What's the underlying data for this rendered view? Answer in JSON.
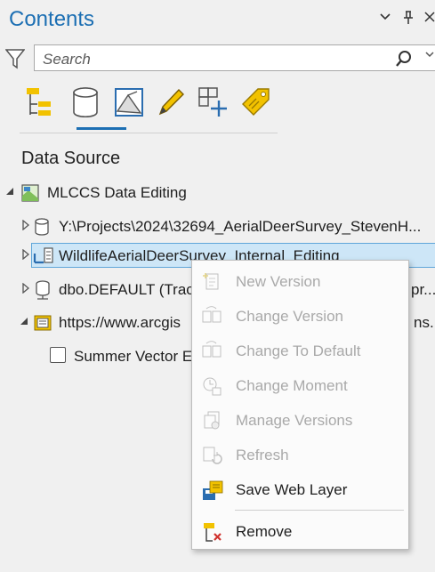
{
  "pane": {
    "title": "Contents",
    "controls": [
      "chevron-down-icon",
      "pin-icon",
      "close-icon"
    ]
  },
  "search": {
    "placeholder": "Search"
  },
  "toolbar": {
    "tools": [
      "list-by-drawing-order-icon",
      "list-by-data-source-icon",
      "list-by-selection-icon",
      "list-by-editing-icon",
      "list-by-snapping-icon",
      "list-by-labeling-icon"
    ],
    "active": "list-by-data-source-icon"
  },
  "section_heading": "Data Source",
  "tree": {
    "map_name": "MLCCS Data Editing",
    "sources": [
      "Y:\\Projects\\2024\\32694_AerialDeerSurvey_StevenH...",
      "WildlifeAerialDeerSurvey_Internal_Editing",
      "dbo.DEFAULT (Trac",
      "https://www.arcgis"
    ],
    "source_suffixes": [
      "",
      "",
      "pr...",
      "ns..."
    ],
    "layer": "Summer Vector E"
  },
  "context_menu": {
    "items": [
      {
        "label": "New Version",
        "enabled": false,
        "icon": "new-version-icon"
      },
      {
        "label": "Change Version",
        "enabled": false,
        "icon": "change-version-icon"
      },
      {
        "label": "Change To Default",
        "enabled": false,
        "icon": "change-to-default-icon"
      },
      {
        "label": "Change Moment",
        "enabled": false,
        "icon": "change-moment-icon"
      },
      {
        "label": "Manage Versions",
        "enabled": false,
        "icon": "manage-versions-icon"
      },
      {
        "label": "Refresh",
        "enabled": false,
        "icon": "refresh-icon"
      },
      {
        "label": "Save Web Layer",
        "enabled": true,
        "icon": "save-web-layer-icon"
      },
      {
        "label": "Remove",
        "enabled": true,
        "icon": "remove-icon"
      }
    ]
  },
  "colors": {
    "accent": "#1c6fb3",
    "selection": "#cde6f7",
    "disabled_text": "#a9a9a9"
  }
}
